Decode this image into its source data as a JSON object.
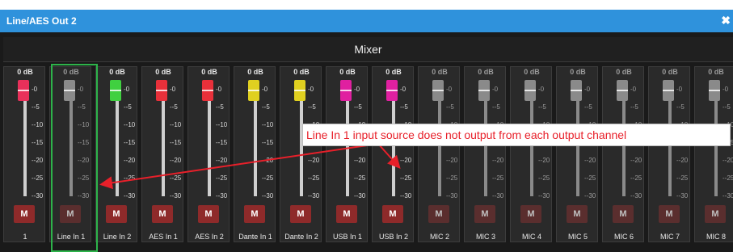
{
  "window": {
    "title": "Line/AES Out 2",
    "close_symbol": "✖"
  },
  "mixer_title": "Mixer",
  "scale_labels": [
    "0",
    "-5",
    "-10",
    "-15",
    "-20",
    "-25",
    "-30"
  ],
  "mute_label": "M",
  "channels": [
    {
      "name": "1",
      "level_db": "0 dB",
      "knob_color": "#e8305a",
      "active": true
    },
    {
      "name": "Line In 1",
      "level_db": "0 dB",
      "knob_color": "#8a8a8a",
      "active": false
    },
    {
      "name": "Line In 2",
      "level_db": "0 dB",
      "knob_color": "#40d040",
      "active": true
    },
    {
      "name": "AES In 1",
      "level_db": "0 dB",
      "knob_color": "#e8303a",
      "active": true
    },
    {
      "name": "AES In 2",
      "level_db": "0 dB",
      "knob_color": "#e8303a",
      "active": true
    },
    {
      "name": "Dante In 1",
      "level_db": "0 dB",
      "knob_color": "#e0d020",
      "active": true
    },
    {
      "name": "Dante In 2",
      "level_db": "0 dB",
      "knob_color": "#e0d020",
      "active": true
    },
    {
      "name": "USB In 1",
      "level_db": "0 dB",
      "knob_color": "#e020a0",
      "active": true
    },
    {
      "name": "USB In 2",
      "level_db": "0 dB",
      "knob_color": "#e020a0",
      "active": true
    },
    {
      "name": "MIC 2",
      "level_db": "0 dB",
      "knob_color": "#8a8a8a",
      "active": false
    },
    {
      "name": "MIC 3",
      "level_db": "0 dB",
      "knob_color": "#8a8a8a",
      "active": false
    },
    {
      "name": "MIC 4",
      "level_db": "0 dB",
      "knob_color": "#8a8a8a",
      "active": false
    },
    {
      "name": "MIC 5",
      "level_db": "0 dB",
      "knob_color": "#8a8a8a",
      "active": false
    },
    {
      "name": "MIC 6",
      "level_db": "0 dB",
      "knob_color": "#8a8a8a",
      "active": false
    },
    {
      "name": "MIC 7",
      "level_db": "0 dB",
      "knob_color": "#8a8a8a",
      "active": false
    },
    {
      "name": "MIC 8",
      "level_db": "0 dB",
      "knob_color": "#8a8a8a",
      "active": false
    }
  ],
  "annotation": {
    "text": "Line In 1 input source does not output from each output channel",
    "color": "#e8202a",
    "highlight_color": "#2db34a"
  }
}
